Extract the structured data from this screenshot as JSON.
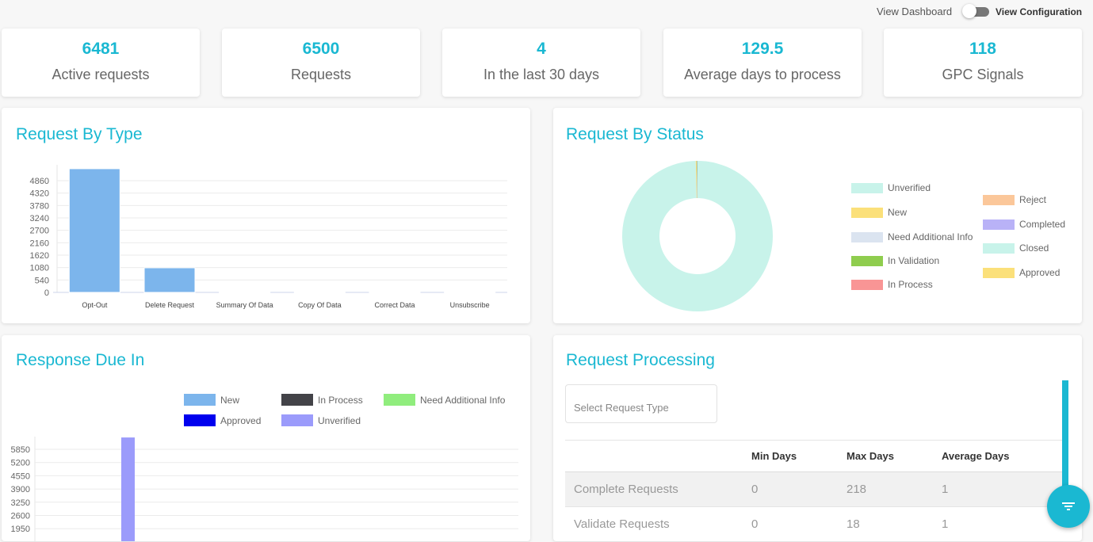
{
  "topbar": {
    "view_dashboard_label": "View Dashboard",
    "view_configuration_label": "View Configuration",
    "toggle_state": "configuration"
  },
  "stats": [
    {
      "value": "6481",
      "label": "Active requests"
    },
    {
      "value": "6500",
      "label": "Requests"
    },
    {
      "value": "4",
      "label": "In the last 30 days"
    },
    {
      "value": "129.5",
      "label": "Average days to process"
    },
    {
      "value": "118",
      "label": "GPC Signals"
    }
  ],
  "colors": {
    "accent": "#1ab8d2"
  },
  "panels": {
    "request_by_type": {
      "title": "Request By Type"
    },
    "request_by_status": {
      "title": "Request By Status"
    },
    "response_due_in": {
      "title": "Response Due In"
    },
    "request_processing": {
      "title": "Request Processing",
      "select_placeholder": "Select Request Type",
      "columns": [
        "",
        "Min Days",
        "Max Days",
        "Average Days"
      ],
      "rows": [
        [
          "Complete Requests",
          "0",
          "218",
          "1"
        ],
        [
          "Validate Requests",
          "0",
          "18",
          "1"
        ]
      ],
      "filter_icon": "filter-icon"
    }
  },
  "chart_data": [
    {
      "type": "bar",
      "title": "Request By Type",
      "categories": [
        "Opt-Out",
        "Delete Request",
        "Summary Of Data",
        "Copy Of Data",
        "Correct Data",
        "Unsubscribe"
      ],
      "values": [
        5380,
        1070,
        5,
        30,
        5,
        5
      ],
      "yticks": [
        "0",
        "540",
        "1080",
        "1620",
        "2160",
        "2700",
        "3240",
        "3780",
        "4320",
        "4860"
      ],
      "ylim": [
        0,
        5400
      ],
      "color": "#7cb5ec",
      "grid": true
    },
    {
      "type": "pie",
      "title": "Request By Status",
      "donut": true,
      "legend_placement": "right",
      "slices": [
        {
          "label": "Unverified",
          "value": 6432,
          "color": "#c8f3ea"
        },
        {
          "label": "New",
          "value": 12,
          "color": "#fbe07a"
        },
        {
          "label": "Need Additional Info",
          "value": 0,
          "color": "#dbe4f0"
        },
        {
          "label": "In Validation",
          "value": 6,
          "color": "#8fcd4e"
        },
        {
          "label": "In Process",
          "value": 0,
          "color": "#f99595"
        },
        {
          "label": "Reject",
          "value": 0,
          "color": "#fbc79a"
        },
        {
          "label": "Completed",
          "value": 6,
          "color": "#b9b2f7"
        },
        {
          "label": "Closed",
          "value": 0,
          "color": "#c8f3ea"
        },
        {
          "label": "Approved",
          "value": 0,
          "color": "#fbe07a"
        }
      ]
    },
    {
      "type": "bar",
      "title": "Response Due In",
      "legend_placement": "top-right",
      "series": [
        {
          "name": "New",
          "color": "#7cb5ec",
          "values": [
            0
          ]
        },
        {
          "name": "In Process",
          "color": "#434348",
          "values": [
            0
          ]
        },
        {
          "name": "Need Additional Info",
          "color": "#90ed7d",
          "values": [
            0
          ]
        },
        {
          "name": "Approved",
          "color": "#0000ee",
          "values": [
            0
          ]
        },
        {
          "name": "Unverified",
          "color": "#9b9bfb",
          "values": [
            6430
          ]
        }
      ],
      "yticks_visible": [
        "1950",
        "2600",
        "3250",
        "3900",
        "4550",
        "5200",
        "5850"
      ],
      "ylim": [
        0,
        6500
      ],
      "grid": true
    }
  ]
}
